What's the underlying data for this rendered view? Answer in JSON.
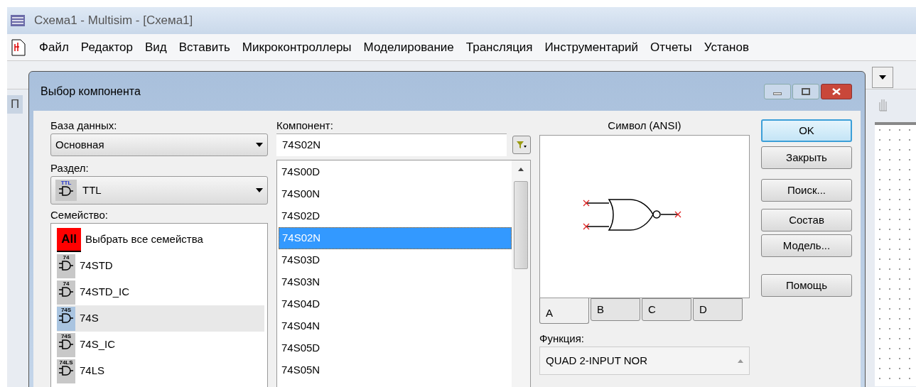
{
  "window": {
    "title": "Схема1 - Multisim - [Схема1]"
  },
  "menu": [
    "Файл",
    "Редактор",
    "Вид",
    "Вставить",
    "Микроконтроллеры",
    "Моделирование",
    "Трансляция",
    "Инструментарий",
    "Отчеты",
    "Установ"
  ],
  "left_panel_tab": "П",
  "dialog": {
    "title": "Выбор компонента",
    "database": {
      "label": "База данных:",
      "value": "Основная"
    },
    "section": {
      "label": "Раздел:",
      "value": "TTL",
      "icon_label": "TTL"
    },
    "family": {
      "label": "Семейство:",
      "items": [
        {
          "kind": "all",
          "icon_label": "All",
          "label": "Выбрать все семейства",
          "selected": false
        },
        {
          "kind": "gate",
          "icon_label": "74",
          "label": "74STD",
          "selected": false
        },
        {
          "kind": "gate",
          "icon_label": "74",
          "label": "74STD_IC",
          "selected": false
        },
        {
          "kind": "gate",
          "icon_label": "74S",
          "label": "74S",
          "selected": true
        },
        {
          "kind": "gate",
          "icon_label": "74S",
          "label": "74S_IC",
          "selected": false
        },
        {
          "kind": "gate",
          "icon_label": "74LS",
          "label": "74LS",
          "selected": false
        }
      ]
    },
    "component": {
      "label": "Компонент:",
      "value": "74S02N",
      "items": [
        {
          "label": "74S00D",
          "selected": false
        },
        {
          "label": "74S00N",
          "selected": false
        },
        {
          "label": "74S02D",
          "selected": false
        },
        {
          "label": "74S02N",
          "selected": true
        },
        {
          "label": "74S03D",
          "selected": false
        },
        {
          "label": "74S03N",
          "selected": false
        },
        {
          "label": "74S04D",
          "selected": false
        },
        {
          "label": "74S04N",
          "selected": false
        },
        {
          "label": "74S05D",
          "selected": false
        },
        {
          "label": "74S05N",
          "selected": false
        }
      ]
    },
    "symbol": {
      "label": "Символ (ANSI)",
      "tabs": [
        {
          "label": "A",
          "selected": true
        },
        {
          "label": "B",
          "selected": false
        },
        {
          "label": "C",
          "selected": false
        },
        {
          "label": "D",
          "selected": false
        }
      ]
    },
    "function": {
      "label": "Функция:",
      "value": "QUAD 2-INPUT NOR"
    },
    "buttons": [
      {
        "label": "OK",
        "default": true
      },
      {
        "label": "Закрыть",
        "default": false
      },
      {
        "label": "Поиск...",
        "default": false
      },
      {
        "label": "Состав",
        "default": false
      },
      {
        "label": "Модель...",
        "default": false
      },
      {
        "label": "Помощь",
        "default": false
      }
    ]
  }
}
